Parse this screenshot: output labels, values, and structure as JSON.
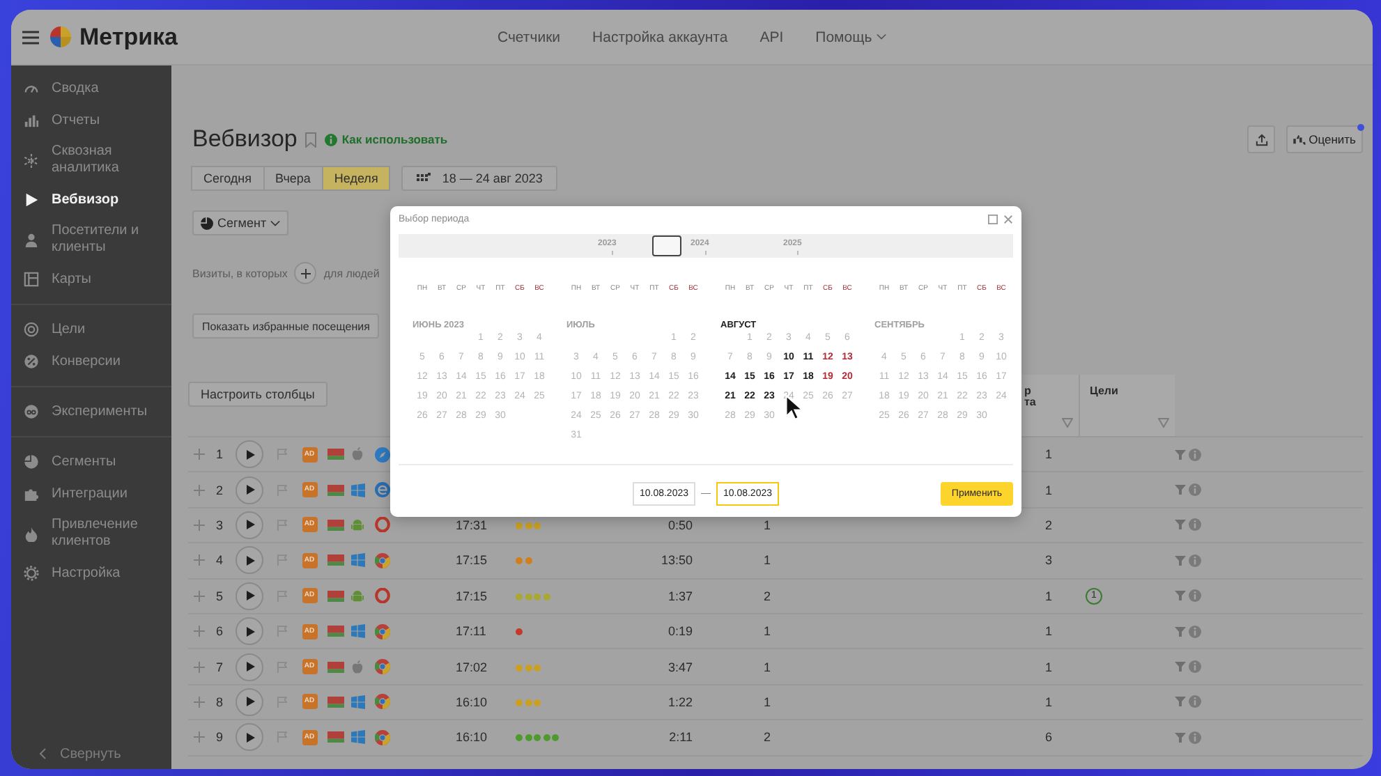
{
  "header": {
    "app": "Метрика",
    "nav": [
      {
        "label": "Счетчики",
        "dropdown": false
      },
      {
        "label": "Настройка аккаунта",
        "dropdown": false
      },
      {
        "label": "API",
        "dropdown": false
      },
      {
        "label": "Помощь",
        "dropdown": true
      }
    ]
  },
  "sidebar": {
    "groups": [
      {
        "items": [
          {
            "label": "Сводка",
            "selected": false
          },
          {
            "label": "Отчеты",
            "selected": false
          },
          {
            "label": "Сквозная аналитика",
            "selected": false
          },
          {
            "label": "Вебвизор",
            "selected": true
          },
          {
            "label": "Посетители и клиенты",
            "selected": false
          },
          {
            "label": "Карты",
            "selected": false
          }
        ]
      },
      {
        "items": [
          {
            "label": "Цели",
            "selected": false
          },
          {
            "label": "Конверсии",
            "selected": false
          }
        ]
      },
      {
        "items": [
          {
            "label": "Эксперименты",
            "selected": false
          }
        ]
      },
      {
        "items": [
          {
            "label": "Сегменты",
            "selected": false
          },
          {
            "label": "Интеграции",
            "selected": false
          },
          {
            "label": "Привлечение клиентов",
            "selected": false
          },
          {
            "label": "Настройка",
            "selected": false
          }
        ]
      }
    ],
    "collapse": "Свернуть"
  },
  "page": {
    "title": "Вебвизор",
    "help": "Как использовать",
    "rate": "Оценить",
    "rate_notice": true,
    "period_tabs": [
      {
        "label": "Сегодня",
        "selected": false
      },
      {
        "label": "Вчера",
        "selected": false
      },
      {
        "label": "Неделя",
        "selected": true
      }
    ],
    "date_range": "18 — 24 авг 2023",
    "segment": "Сегмент",
    "filter_prefix": "Визиты, в которых",
    "filter_suffix": "для людей",
    "favorites": "Показать избранные посещения",
    "columns_button": "Настроить столбцы"
  },
  "table": {
    "headers": [
      "р\nта",
      "Цели"
    ],
    "rows": [
      {
        "number": "1",
        "source": "AD",
        "icons": [
          {
            "kind": "apple"
          },
          {
            "kind": "safari"
          }
        ],
        "column_5": "1"
      },
      {
        "number": "2",
        "source": "AD",
        "icons": [
          {
            "kind": "windows"
          },
          {
            "kind": "edge"
          }
        ],
        "column_5": "1"
      },
      {
        "number": "3",
        "source": "AD",
        "icons": [
          {
            "kind": "android"
          },
          {
            "kind": "opera"
          }
        ],
        "column_1": "17:31",
        "column_2": [
          {
            "color": "#c9a020"
          },
          {
            "color": "#c9a020"
          },
          {
            "color": "#c9a020"
          }
        ],
        "column_3": "0:50",
        "column_4": "1",
        "column_5": "2"
      },
      {
        "number": "4",
        "source": "AD",
        "icons": [
          {
            "kind": "windows"
          },
          {
            "kind": "chrome"
          }
        ],
        "column_1": "17:15",
        "column_2": [
          {
            "color": "#d07f1c"
          },
          {
            "color": "#d07f1c"
          }
        ],
        "column_3": "13:50",
        "column_4": "1",
        "column_5": "3"
      },
      {
        "number": "5",
        "source": "AD",
        "icons": [
          {
            "kind": "android"
          },
          {
            "kind": "opera"
          }
        ],
        "column_1": "17:15",
        "column_2": [
          {
            "color": "#a8a832"
          },
          {
            "color": "#a8a832"
          },
          {
            "color": "#a8a832"
          },
          {
            "color": "#a8a832"
          }
        ],
        "column_3": "1:37",
        "column_4": "2",
        "column_5": "1",
        "goals": "1"
      },
      {
        "number": "6",
        "source": "AD",
        "icons": [
          {
            "kind": "windows"
          },
          {
            "kind": "chrome"
          }
        ],
        "column_1": "17:11",
        "column_2": [
          {
            "color": "#c23a2a"
          }
        ],
        "column_3": "0:19",
        "column_4": "1",
        "column_5": "1"
      },
      {
        "number": "7",
        "source": "AD",
        "icons": [
          {
            "kind": "apple"
          },
          {
            "kind": "chrome"
          }
        ],
        "column_1": "17:02",
        "column_2": [
          {
            "color": "#c9a020"
          },
          {
            "color": "#c9a020"
          },
          {
            "color": "#c9a020"
          }
        ],
        "column_3": "3:47",
        "column_4": "1",
        "column_5": "1"
      },
      {
        "number": "8",
        "source": "AD",
        "icons": [
          {
            "kind": "windows"
          },
          {
            "kind": "chrome"
          }
        ],
        "column_1": "16:10",
        "column_2": [
          {
            "color": "#c9a020"
          },
          {
            "color": "#c9a020"
          },
          {
            "color": "#c9a020"
          }
        ],
        "column_3": "1:22",
        "column_4": "1",
        "column_5": "1"
      },
      {
        "number": "9",
        "source": "AD",
        "icons": [
          {
            "kind": "windows"
          },
          {
            "kind": "chrome"
          }
        ],
        "column_1": "16:10",
        "column_2": [
          {
            "color": "#4f9a2c"
          },
          {
            "color": "#4f9a2c"
          },
          {
            "color": "#4f9a2c"
          },
          {
            "color": "#4f9a2c"
          },
          {
            "color": "#4f9a2c"
          }
        ],
        "column_3": "2:11",
        "column_4": "2",
        "column_5": "6"
      }
    ]
  },
  "dialog": {
    "title": "Выбор периода",
    "years": [
      "2023",
      "2024",
      "2025"
    ],
    "months": [
      {
        "title": "ИЮНЬ 2023",
        "selected": false,
        "weekdays": [
          {
            "label": "ПН",
            "weekend": false
          },
          {
            "label": "ВТ",
            "weekend": false
          },
          {
            "label": "СР",
            "weekend": false
          },
          {
            "label": "ЧТ",
            "weekend": false
          },
          {
            "label": "ПТ",
            "weekend": false
          },
          {
            "label": "СБ",
            "weekend": true
          },
          {
            "label": "ВС",
            "weekend": true
          }
        ],
        "weeks": [
          {
            "pad_start": true,
            "days": [
              {
                "d": "1",
                "active": false
              },
              {
                "d": "2",
                "active": false
              },
              {
                "d": "3",
                "active": false
              },
              {
                "d": "4",
                "active": false
              }
            ]
          },
          {
            "days": [
              {
                "d": "5",
                "active": false
              },
              {
                "d": "6",
                "active": false
              },
              {
                "d": "7",
                "active": false
              },
              {
                "d": "8",
                "active": false
              },
              {
                "d": "9",
                "active": false
              },
              {
                "d": "10",
                "active": false
              },
              {
                "d": "11",
                "active": false
              }
            ]
          },
          {
            "days": [
              {
                "d": "12",
                "active": false
              },
              {
                "d": "13",
                "active": false
              },
              {
                "d": "14",
                "active": false
              },
              {
                "d": "15",
                "active": false
              },
              {
                "d": "16",
                "active": false
              },
              {
                "d": "17",
                "active": false
              },
              {
                "d": "18",
                "active": false
              }
            ]
          },
          {
            "days": [
              {
                "d": "19",
                "active": false
              },
              {
                "d": "20",
                "active": false
              },
              {
                "d": "21",
                "active": false
              },
              {
                "d": "22",
                "active": false
              },
              {
                "d": "23",
                "active": false
              },
              {
                "d": "24",
                "active": false
              },
              {
                "d": "25",
                "active": false
              }
            ]
          },
          {
            "pad_start": false,
            "days": [
              {
                "d": "26",
                "active": false
              },
              {
                "d": "27",
                "active": false
              },
              {
                "d": "28",
                "active": false
              },
              {
                "d": "29",
                "active": false
              },
              {
                "d": "30",
                "active": false
              }
            ]
          }
        ]
      },
      {
        "title": "ИЮЛЬ",
        "selected": false,
        "weekdays": [
          {
            "label": "ПН",
            "weekend": false
          },
          {
            "label": "ВТ",
            "weekend": false
          },
          {
            "label": "СР",
            "weekend": false
          },
          {
            "label": "ЧТ",
            "weekend": false
          },
          {
            "label": "ПТ",
            "weekend": false
          },
          {
            "label": "СБ",
            "weekend": true
          },
          {
            "label": "ВС",
            "weekend": true
          }
        ],
        "weeks": [
          {
            "pad_start": true,
            "days": [
              {
                "d": "1",
                "active": false
              },
              {
                "d": "2",
                "active": false
              }
            ]
          },
          {
            "days": [
              {
                "d": "3",
                "active": false
              },
              {
                "d": "4",
                "active": false
              },
              {
                "d": "5",
                "active": false
              },
              {
                "d": "6",
                "active": false
              },
              {
                "d": "7",
                "active": false
              },
              {
                "d": "8",
                "active": false
              },
              {
                "d": "9",
                "active": false
              }
            ]
          },
          {
            "days": [
              {
                "d": "10",
                "active": false
              },
              {
                "d": "11",
                "active": false
              },
              {
                "d": "12",
                "active": false
              },
              {
                "d": "13",
                "active": false
              },
              {
                "d": "14",
                "active": false
              },
              {
                "d": "15",
                "active": false
              },
              {
                "d": "16",
                "active": false
              }
            ]
          },
          {
            "days": [
              {
                "d": "17",
                "active": false
              },
              {
                "d": "18",
                "active": false
              },
              {
                "d": "19",
                "active": false
              },
              {
                "d": "20",
                "active": false
              },
              {
                "d": "21",
                "active": false
              },
              {
                "d": "22",
                "active": false
              },
              {
                "d": "23",
                "active": false
              }
            ]
          },
          {
            "days": [
              {
                "d": "24",
                "active": false
              },
              {
                "d": "25",
                "active": false
              },
              {
                "d": "26",
                "active": false
              },
              {
                "d": "27",
                "active": false
              },
              {
                "d": "28",
                "active": false
              },
              {
                "d": "29",
                "active": false
              },
              {
                "d": "30",
                "active": false
              }
            ]
          },
          {
            "pad_start": false,
            "days": [
              {
                "d": "31",
                "active": false
              }
            ]
          }
        ]
      },
      {
        "title": "АВГУСТ",
        "selected": true,
        "weekdays": [
          {
            "label": "ПН",
            "weekend": false
          },
          {
            "label": "ВТ",
            "weekend": false
          },
          {
            "label": "СР",
            "weekend": false
          },
          {
            "label": "ЧТ",
            "weekend": false
          },
          {
            "label": "ПТ",
            "weekend": false
          },
          {
            "label": "СБ",
            "weekend": true
          },
          {
            "label": "ВС",
            "weekend": true
          }
        ],
        "weeks": [
          {
            "pad_start": true,
            "days": [
              {
                "d": "1",
                "active": false
              },
              {
                "d": "2",
                "active": false
              },
              {
                "d": "3",
                "active": false
              },
              {
                "d": "4",
                "active": false
              },
              {
                "d": "5",
                "active": false
              },
              {
                "d": "6",
                "active": false
              }
            ]
          },
          {
            "days": [
              {
                "d": "7",
                "active": false
              },
              {
                "d": "8",
                "active": false
              },
              {
                "d": "9",
                "active": false
              },
              {
                "d": "10",
                "active": true
              },
              {
                "d": "11",
                "active": true
              },
              {
                "d": "12",
                "active": true
              },
              {
                "d": "13",
                "active": true
              }
            ]
          },
          {
            "days": [
              {
                "d": "14",
                "active": true
              },
              {
                "d": "15",
                "active": true
              },
              {
                "d": "16",
                "active": true
              },
              {
                "d": "17",
                "active": true
              },
              {
                "d": "18",
                "active": true
              },
              {
                "d": "19",
                "active": true
              },
              {
                "d": "20",
                "active": true
              }
            ]
          },
          {
            "days": [
              {
                "d": "21",
                "active": true
              },
              {
                "d": "22",
                "active": true
              },
              {
                "d": "23",
                "active": true
              },
              {
                "d": "24",
                "active": false
              },
              {
                "d": "25",
                "active": false
              },
              {
                "d": "26",
                "active": false
              },
              {
                "d": "27",
                "active": false
              }
            ]
          },
          {
            "pad_start": false,
            "days": [
              {
                "d": "28",
                "active": false
              },
              {
                "d": "29",
                "active": false
              },
              {
                "d": "30",
                "active": false
              }
            ]
          }
        ]
      },
      {
        "title": "СЕНТЯБРЬ",
        "selected": false,
        "weekdays": [
          {
            "label": "ПН",
            "weekend": false
          },
          {
            "label": "ВТ",
            "weekend": false
          },
          {
            "label": "СР",
            "weekend": false
          },
          {
            "label": "ЧТ",
            "weekend": false
          },
          {
            "label": "ПТ",
            "weekend": false
          },
          {
            "label": "СБ",
            "weekend": true
          },
          {
            "label": "ВС",
            "weekend": true
          }
        ],
        "weeks": [
          {
            "pad_start": true,
            "days": [
              {
                "d": "1",
                "active": false
              },
              {
                "d": "2",
                "active": false
              },
              {
                "d": "3",
                "active": false
              }
            ]
          },
          {
            "days": [
              {
                "d": "4",
                "active": false
              },
              {
                "d": "5",
                "active": false
              },
              {
                "d": "6",
                "active": false
              },
              {
                "d": "7",
                "active": false
              },
              {
                "d": "8",
                "active": false
              },
              {
                "d": "9",
                "active": false
              },
              {
                "d": "10",
                "active": false
              }
            ]
          },
          {
            "days": [
              {
                "d": "11",
                "active": false
              },
              {
                "d": "12",
                "active": false
              },
              {
                "d": "13",
                "active": false
              },
              {
                "d": "14",
                "active": false
              },
              {
                "d": "15",
                "active": false
              },
              {
                "d": "16",
                "active": false
              },
              {
                "d": "17",
                "active": false
              }
            ]
          },
          {
            "days": [
              {
                "d": "18",
                "active": false
              },
              {
                "d": "19",
                "active": false
              },
              {
                "d": "20",
                "active": false
              },
              {
                "d": "21",
                "active": false
              },
              {
                "d": "22",
                "active": false
              },
              {
                "d": "23",
                "active": false
              },
              {
                "d": "24",
                "active": false
              }
            ]
          },
          {
            "pad_start": false,
            "days": [
              {
                "d": "25",
                "active": false
              },
              {
                "d": "26",
                "active": false
              },
              {
                "d": "27",
                "active": false
              },
              {
                "d": "28",
                "active": false
              },
              {
                "d": "29",
                "active": false
              },
              {
                "d": "30",
                "active": false
              }
            ]
          }
        ]
      }
    ],
    "from": {
      "value": "10.08.2023",
      "focused": false
    },
    "separator": "—",
    "to": {
      "value": "10.08.2023",
      "focused": true
    },
    "apply": "Применить"
  }
}
